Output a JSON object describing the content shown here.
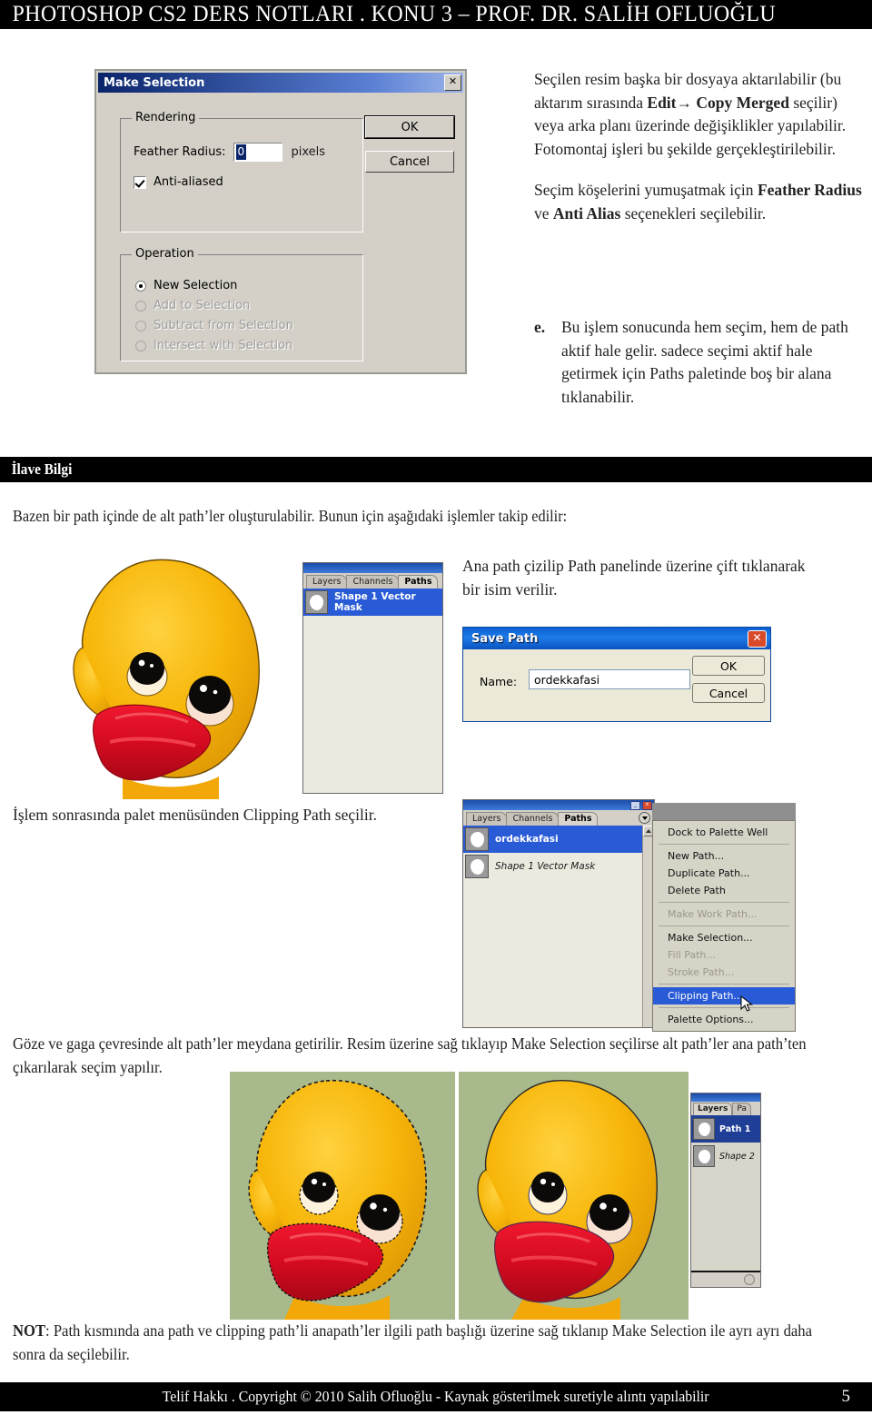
{
  "header": {
    "title": "PHOTOSHOP CS2 DERS NOTLARI . KONU 3 – PROF. DR. SALİH OFLUOĞLU"
  },
  "make_selection_dialog": {
    "title": "Make Selection",
    "close_label": "✕",
    "rendering_legend": "Rendering",
    "feather_label": "Feather Radius:",
    "feather_value": "0",
    "feather_units": "pixels",
    "anti_aliased_label": "Anti-aliased",
    "operation_legend": "Operation",
    "operations": [
      {
        "label": "New Selection",
        "selected": true,
        "enabled": true
      },
      {
        "label": "Add to Selection",
        "selected": false,
        "enabled": false
      },
      {
        "label": "Subtract from Selection",
        "selected": false,
        "enabled": false
      },
      {
        "label": "Intersect with Selection",
        "selected": false,
        "enabled": false
      }
    ],
    "ok_label": "OK",
    "cancel_label": "Cancel"
  },
  "intro_text": {
    "para1_a": "Seçilen resim başka bir dosyaya aktarılabilir (bu aktarım sırasında ",
    "para1_bold": "Edit→ Copy Merged",
    "para1_b": " seçilir) veya arka planı üzerinde değişiklikler yapılabilir. Fotomontaj işleri bu şekilde gerçekleştirilebilir.",
    "para2_a": "Seçim köşelerini yumuşatmak için ",
    "para2_bold1": "Feather Radius",
    "para2_mid": " ve ",
    "para2_bold2": "Anti Alias",
    "para2_b": " seçenekleri seçilebilir.",
    "item_e_marker": "e.",
    "item_e_text": "Bu işlem sonucunda hem seçim, hem de path aktif hale gelir. sadece seçimi aktif hale getirmek için Paths paletinde boş bir alana tıklanabilir."
  },
  "ilave": {
    "band_title": "İlave Bilgi",
    "paragraph": "Bazen bir path içinde de alt path’ler oluşturulabilir. Bunun için aşağıdaki işlemler takip edilir:"
  },
  "paths_panel_small": {
    "tabs": [
      "Layers",
      "Channels",
      "Paths"
    ],
    "active_tab": "Paths",
    "rows": [
      {
        "name": "Shape 1 Vector Mask",
        "selected": true
      }
    ]
  },
  "step1_text": "Ana path çizilip Path panelinde üzerine çift tıklanarak bir isim verilir.",
  "save_path_dialog": {
    "title": "Save Path",
    "close_label": "✕",
    "name_label": "Name:",
    "name_value": "ordekkafasi",
    "ok_label": "OK",
    "cancel_label": "Cancel"
  },
  "step2_text": "İşlem sonrasında palet menüsünden Clipping Path seçilir.",
  "paths_panel_menu": {
    "tabs": [
      "Layers",
      "Channels",
      "Paths"
    ],
    "active_tab": "Paths",
    "rows": [
      {
        "name": "ordekkafasi",
        "selected": true
      },
      {
        "name": "Shape 1 Vector Mask",
        "selected": false
      }
    ],
    "menu_items": [
      {
        "label": "Dock to Palette Well",
        "enabled": true,
        "highlighted": false,
        "separator_after": true
      },
      {
        "label": "New Path...",
        "enabled": true,
        "highlighted": false,
        "separator_after": false
      },
      {
        "label": "Duplicate Path...",
        "enabled": true,
        "highlighted": false,
        "separator_after": false
      },
      {
        "label": "Delete Path",
        "enabled": true,
        "highlighted": false,
        "separator_after": true
      },
      {
        "label": "Make Work Path...",
        "enabled": false,
        "highlighted": false,
        "separator_after": true
      },
      {
        "label": "Make Selection...",
        "enabled": true,
        "highlighted": false,
        "separator_after": false
      },
      {
        "label": "Fill Path...",
        "enabled": false,
        "highlighted": false,
        "separator_after": false
      },
      {
        "label": "Stroke Path...",
        "enabled": false,
        "highlighted": false,
        "separator_after": true
      },
      {
        "label": "Clipping Path...",
        "enabled": true,
        "highlighted": true,
        "separator_after": true
      },
      {
        "label": "Palette Options...",
        "enabled": true,
        "highlighted": false,
        "separator_after": false
      }
    ]
  },
  "step3_text": "Göze ve gaga çevresinde alt path’ler meydana getirilir. Resim üzerine sağ tıklayıp Make Selection seçilirse alt path’ler ana path’ten çıkarılarak seçim yapılır.",
  "layers_panel_bottom": {
    "tabs": [
      "Layers",
      "Pa"
    ],
    "active_tab": "Layers",
    "rows": [
      {
        "name": "Path 1",
        "selected": true
      },
      {
        "name": "Shape 2",
        "selected": false
      }
    ]
  },
  "note": {
    "prefix": "NOT",
    "text": ": Path kısmında ana path ve clipping path’li anapath’ler  ilgili path başlığı üzerine sağ tıklanıp Make Selection ile ayrı ayrı daha sonra da seçilebilir."
  },
  "footer": {
    "copyright": "Telif Hakkı . Copyright © 2010 Salih Ofluoğlu - Kaynak gösterilmek suretiyle alıntı yapılabilir",
    "page_number": "5"
  },
  "colors": {
    "band_black": "#000000",
    "duck_yellow": "#f5b50d",
    "duck_beak_red": "#d60b20",
    "green_bg": "#a8ba8c",
    "xp_blue": "#0b5fd4",
    "win2k_blue": "#0a246a",
    "highlight_blue": "#2a5bd7"
  }
}
